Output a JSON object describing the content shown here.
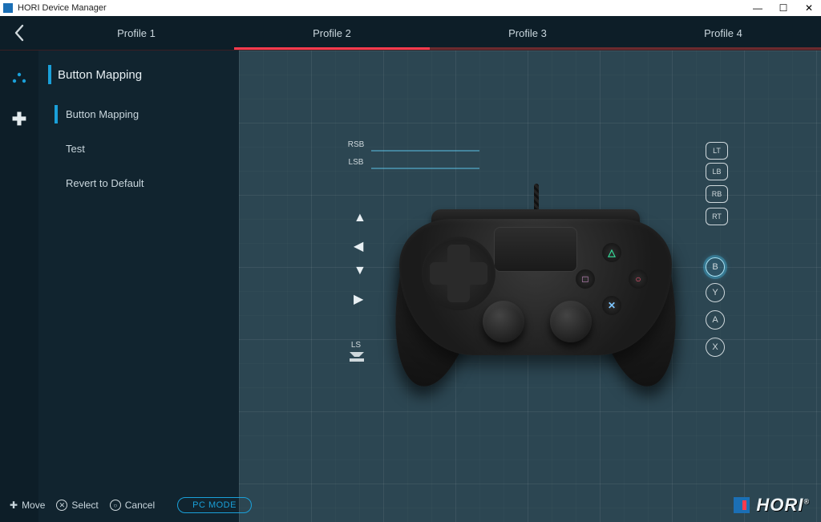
{
  "window": {
    "title": "HORI Device Manager"
  },
  "tabs": [
    "Profile 1",
    "Profile 2",
    "Profile 3",
    "Profile 4"
  ],
  "active_tab_index": 1,
  "sidebar": {
    "heading": "Button Mapping",
    "items": [
      {
        "label": "Button Mapping",
        "selected": true
      },
      {
        "label": "Test",
        "selected": false
      },
      {
        "label": "Revert to Default",
        "selected": false
      }
    ]
  },
  "controller": {
    "left_labels": [
      "RSB",
      "LSB",
      "↑",
      "◀",
      "▼",
      "▶",
      "LS"
    ],
    "right_labels": [
      "LT",
      "LB",
      "RB",
      "RT",
      "B",
      "Y",
      "A",
      "X"
    ],
    "selected_right_label": "B"
  },
  "footer": {
    "move": "Move",
    "select": "Select",
    "cancel": "Cancel",
    "mode": "PC MODE"
  },
  "brand": "HORI",
  "colors": {
    "accent": "#1aa0d9",
    "tab_active": "#ff3b4e",
    "panel": "#2c4652"
  }
}
